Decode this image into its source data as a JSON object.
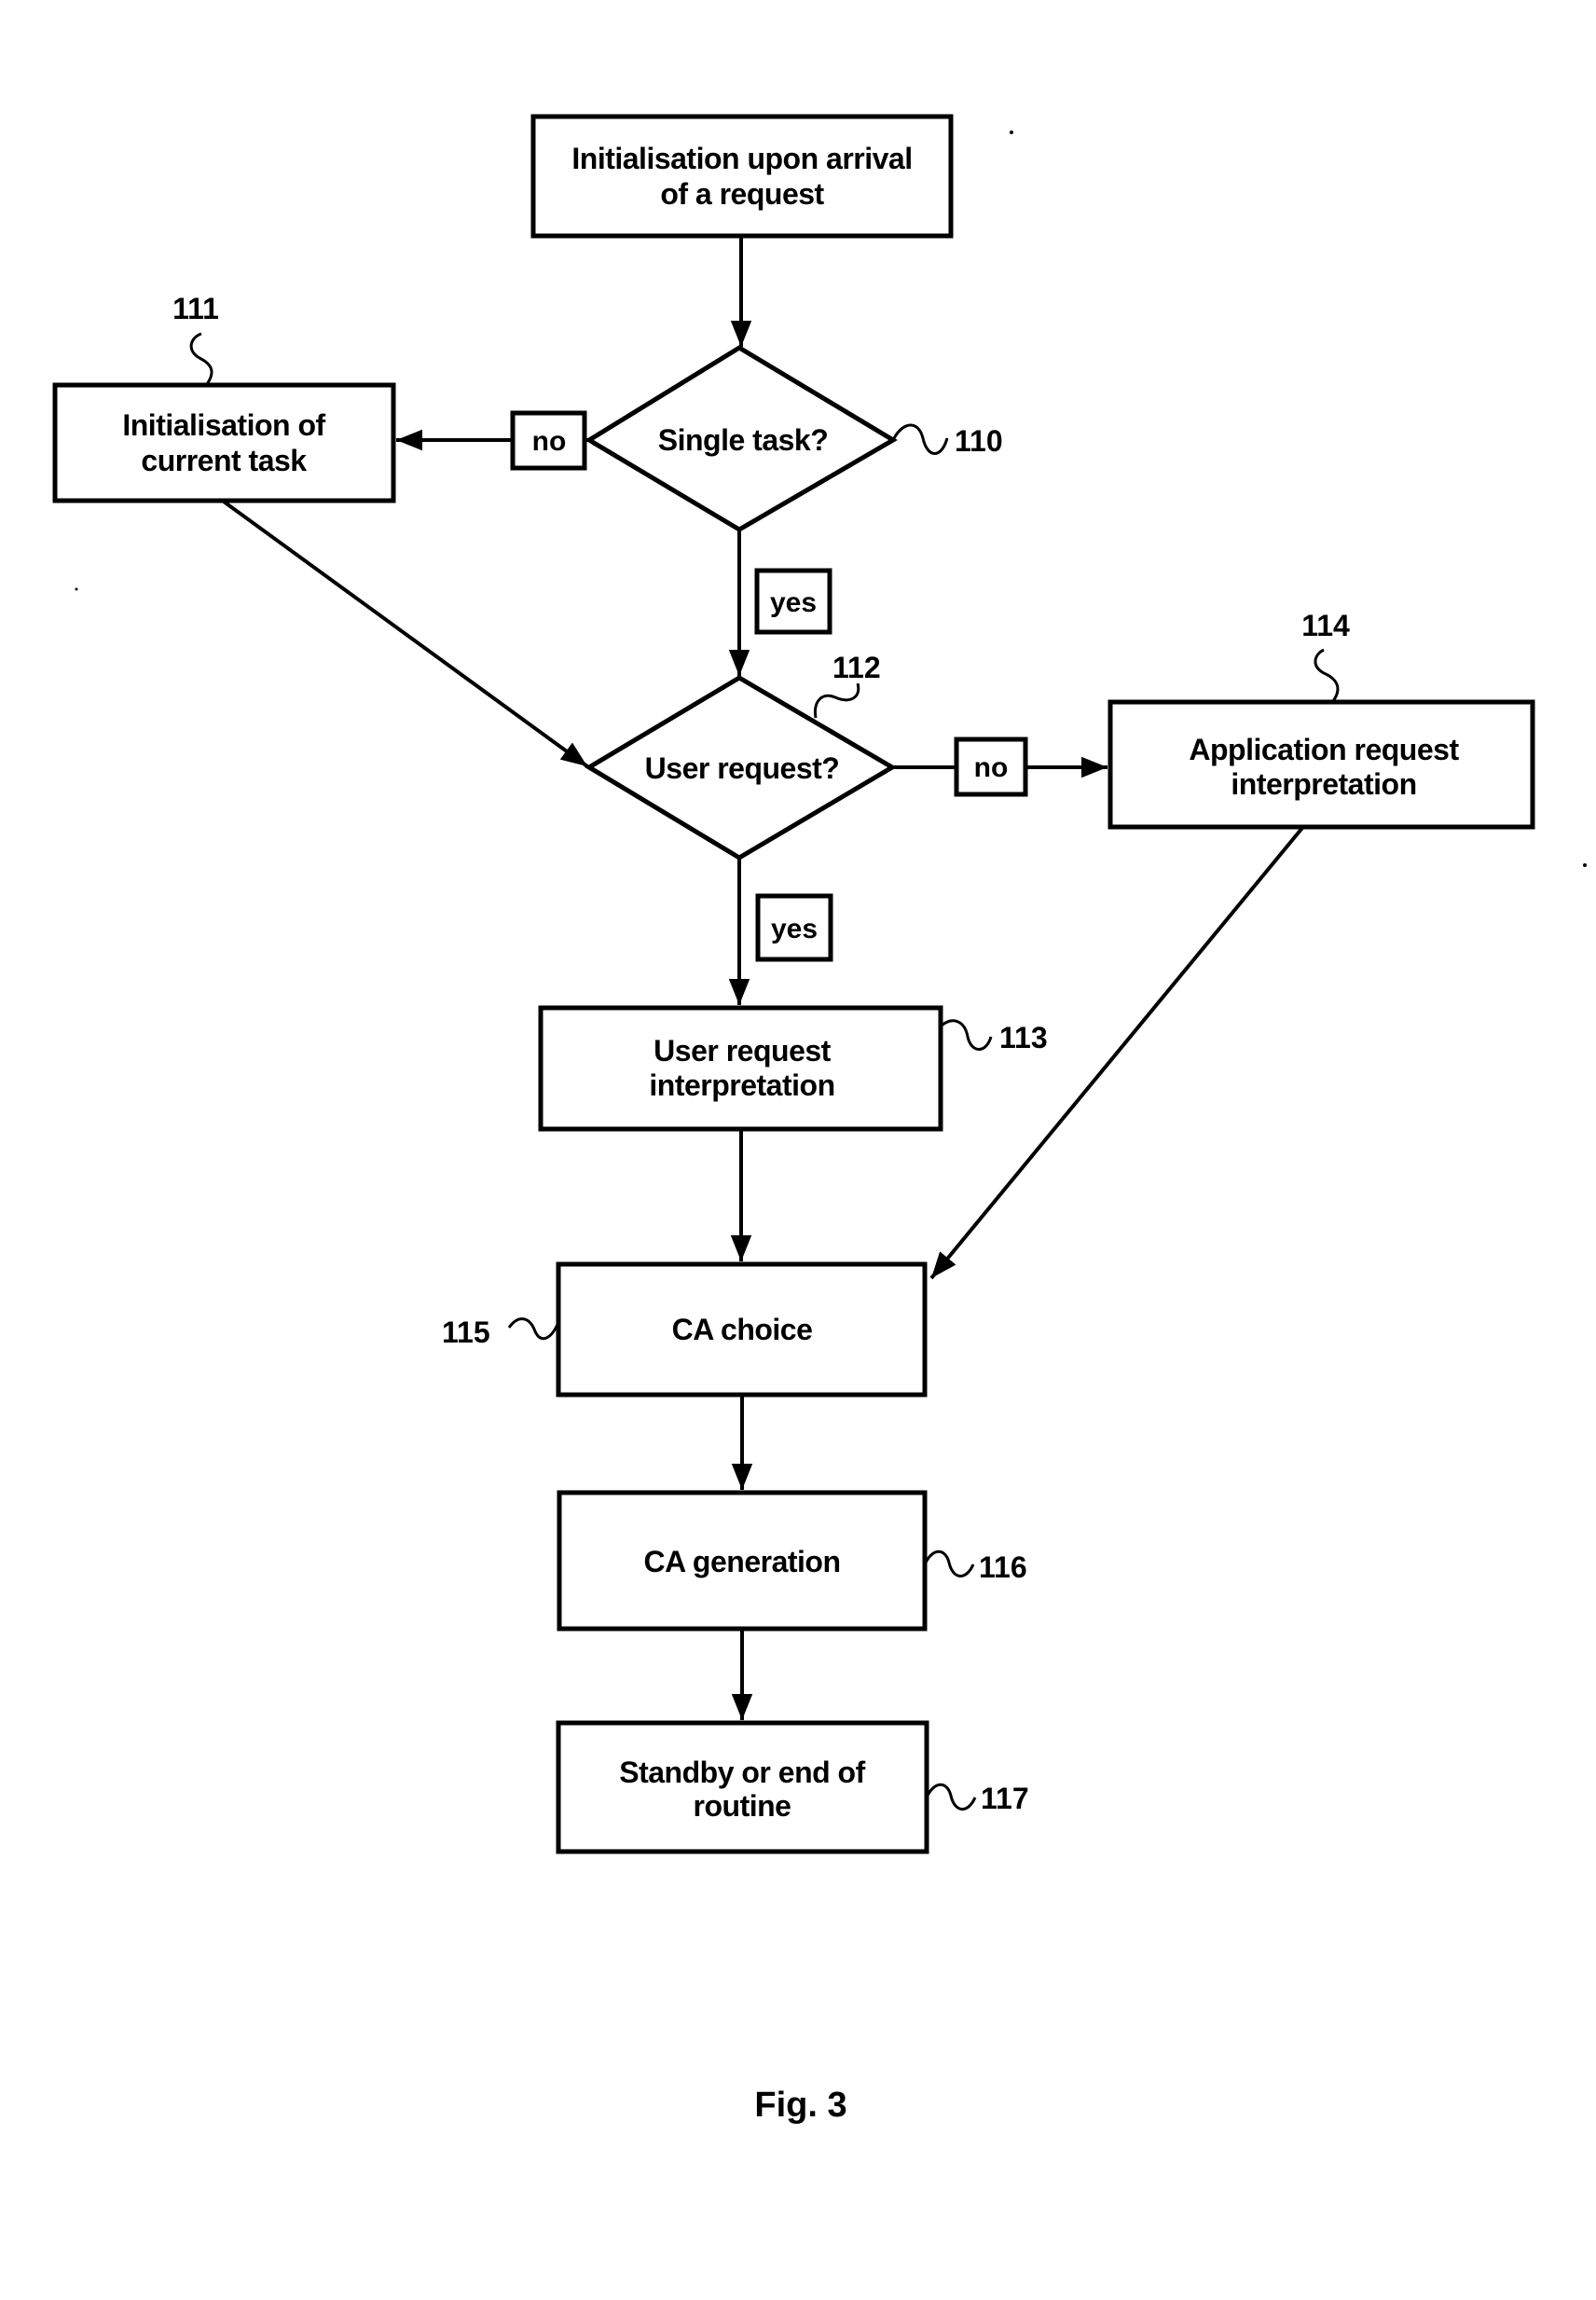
{
  "figure": {
    "caption": "Fig. 3",
    "nodes": {
      "start": {
        "lines": [
          "Initialisation upon arrival",
          "of a request"
        ]
      },
      "d110": {
        "ref": "110",
        "lines": [
          "Single task?"
        ]
      },
      "b111": {
        "ref": "111",
        "lines": [
          "Initialisation of",
          "current task"
        ]
      },
      "d112": {
        "ref": "112",
        "lines": [
          "User request?"
        ]
      },
      "b113": {
        "ref": "113",
        "lines": [
          "User request",
          "interpretation"
        ]
      },
      "b114": {
        "ref": "114",
        "lines": [
          "Application request",
          "interpretation"
        ]
      },
      "b115": {
        "ref": "115",
        "lines": [
          "CA choice"
        ]
      },
      "b116": {
        "ref": "116",
        "lines": [
          "CA generation"
        ]
      },
      "b117": {
        "ref": "117",
        "lines": [
          "Standby or end of",
          "routine"
        ]
      }
    },
    "branch_labels": {
      "d110_no": "no",
      "d110_yes": "yes",
      "d112_no": "no",
      "d112_yes": "yes"
    },
    "edges": [
      {
        "from": "start",
        "to": "d110"
      },
      {
        "from": "d110",
        "to": "b111",
        "label": "no"
      },
      {
        "from": "d110",
        "to": "d112",
        "label": "yes"
      },
      {
        "from": "b111",
        "to": "d112"
      },
      {
        "from": "d112",
        "to": "b114",
        "label": "no"
      },
      {
        "from": "d112",
        "to": "b113",
        "label": "yes"
      },
      {
        "from": "b113",
        "to": "b115"
      },
      {
        "from": "b114",
        "to": "b115"
      },
      {
        "from": "b115",
        "to": "b116"
      },
      {
        "from": "b116",
        "to": "b117"
      }
    ]
  }
}
